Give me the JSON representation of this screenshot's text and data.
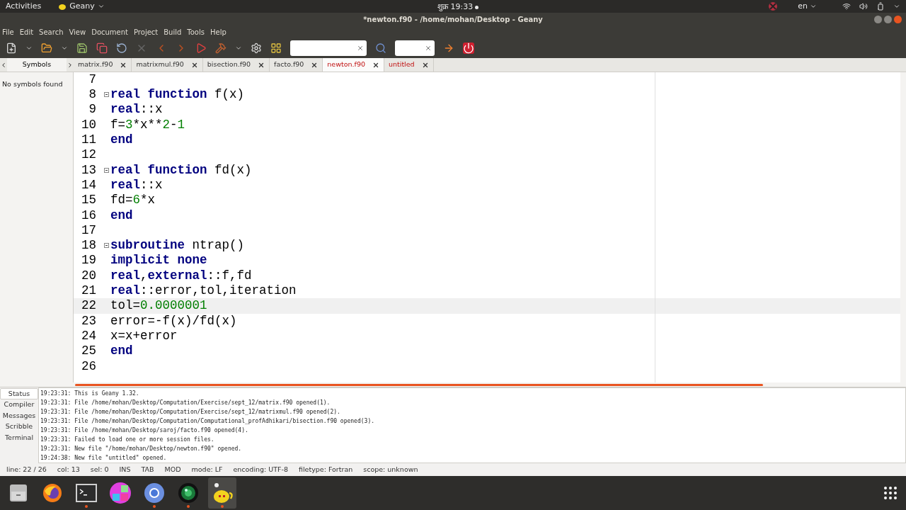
{
  "top_bar": {
    "activities": "Activities",
    "app_menu": "Geany",
    "clock": "शुक्र 19:33",
    "language": "en"
  },
  "window": {
    "title": "*newton.f90 - /home/mohan/Desktop - Geany"
  },
  "menu": [
    "File",
    "Edit",
    "Search",
    "View",
    "Document",
    "Project",
    "Build",
    "Tools",
    "Help"
  ],
  "sidebar": {
    "tab": "Symbols",
    "message": "No symbols found"
  },
  "tabs": [
    {
      "label": "matrix.f90",
      "selected": false,
      "modified": false
    },
    {
      "label": "matrixmul.f90",
      "selected": false,
      "modified": false
    },
    {
      "label": "bisection.f90",
      "selected": false,
      "modified": false
    },
    {
      "label": "facto.f90",
      "selected": false,
      "modified": false
    },
    {
      "label": "newton.f90",
      "selected": true,
      "modified": true
    },
    {
      "label": "untitled",
      "selected": false,
      "modified": true
    }
  ],
  "editor": {
    "lines": [
      {
        "number": "7",
        "fold": false,
        "current": false
      },
      {
        "number": "8",
        "fold": true,
        "current": false,
        "tokens": [
          {
            "t": "real function",
            "kind": "keyword"
          },
          {
            "t": " f(x)",
            "kind": "plain"
          }
        ]
      },
      {
        "number": "9",
        "fold": false,
        "current": false,
        "tokens": [
          {
            "t": "real",
            "kind": "keyword"
          },
          {
            "t": "::x",
            "kind": "plain"
          }
        ]
      },
      {
        "number": "10",
        "fold": false,
        "current": false,
        "tokens": [
          {
            "t": "f=",
            "kind": "plain"
          },
          {
            "t": "3",
            "kind": "number"
          },
          {
            "t": "*x**",
            "kind": "plain"
          },
          {
            "t": "2",
            "kind": "number"
          },
          {
            "t": "-",
            "kind": "plain"
          },
          {
            "t": "1",
            "kind": "number"
          }
        ]
      },
      {
        "number": "11",
        "fold": false,
        "current": false,
        "tokens": [
          {
            "t": "end",
            "kind": "keyword"
          }
        ]
      },
      {
        "number": "12",
        "fold": false,
        "current": false
      },
      {
        "number": "13",
        "fold": true,
        "current": false,
        "tokens": [
          {
            "t": "real function",
            "kind": "keyword"
          },
          {
            "t": " fd(x)",
            "kind": "plain"
          }
        ]
      },
      {
        "number": "14",
        "fold": false,
        "current": false,
        "tokens": [
          {
            "t": "real",
            "kind": "keyword"
          },
          {
            "t": "::x",
            "kind": "plain"
          }
        ]
      },
      {
        "number": "15",
        "fold": false,
        "current": false,
        "tokens": [
          {
            "t": "fd=",
            "kind": "plain"
          },
          {
            "t": "6",
            "kind": "number"
          },
          {
            "t": "*x",
            "kind": "plain"
          }
        ]
      },
      {
        "number": "16",
        "fold": false,
        "current": false,
        "tokens": [
          {
            "t": "end",
            "kind": "keyword"
          }
        ]
      },
      {
        "number": "17",
        "fold": false,
        "current": false
      },
      {
        "number": "18",
        "fold": true,
        "current": false,
        "tokens": [
          {
            "t": "subroutine",
            "kind": "keyword"
          },
          {
            "t": " ntrap()",
            "kind": "plain"
          }
        ]
      },
      {
        "number": "19",
        "fold": false,
        "current": false,
        "tokens": [
          {
            "t": "implicit none",
            "kind": "keyword"
          }
        ]
      },
      {
        "number": "20",
        "fold": false,
        "current": false,
        "tokens": [
          {
            "t": "real",
            "kind": "keyword"
          },
          {
            "t": ",",
            "kind": "plain"
          },
          {
            "t": "external",
            "kind": "keyword"
          },
          {
            "t": "::f,fd",
            "kind": "plain"
          }
        ]
      },
      {
        "number": "21",
        "fold": false,
        "current": false,
        "tokens": [
          {
            "t": "real",
            "kind": "keyword"
          },
          {
            "t": "::error,tol,iteration",
            "kind": "plain"
          }
        ]
      },
      {
        "number": "22",
        "fold": false,
        "current": true,
        "tokens": [
          {
            "t": "tol=",
            "kind": "plain"
          },
          {
            "t": "0.0000001",
            "kind": "number"
          }
        ]
      },
      {
        "number": "23",
        "fold": false,
        "current": false,
        "tokens": [
          {
            "t": "error=-f(x)/fd(x)",
            "kind": "plain"
          }
        ]
      },
      {
        "number": "24",
        "fold": false,
        "current": false,
        "tokens": [
          {
            "t": "x=x+error",
            "kind": "plain"
          }
        ]
      },
      {
        "number": "25",
        "fold": false,
        "current": false,
        "tokens": [
          {
            "t": "end",
            "kind": "keyword"
          }
        ]
      },
      {
        "number": "26",
        "fold": false,
        "current": false
      }
    ]
  },
  "message_tabs": [
    {
      "label": "Status",
      "selected": true
    },
    {
      "label": "Compiler",
      "selected": false
    },
    {
      "label": "Messages",
      "selected": false
    },
    {
      "label": "Scribble",
      "selected": false
    },
    {
      "label": "Terminal",
      "selected": false
    }
  ],
  "messages": [
    "19:23:31: This is Geany 1.32.",
    "19:23:31: File /home/mohan/Desktop/Computation/Exercise/sept_12/matrix.f90 opened(1).",
    "19:23:31: File /home/mohan/Desktop/Computation/Exercise/sept_12/matrixmul.f90 opened(2).",
    "19:23:31: File /home/mohan/Desktop/Computation/Computational_profAdhikari/bisection.f90 opened(3).",
    "19:23:31: File /home/mohan/Desktop/saroj/facto.f90 opened(4).",
    "19:23:31: Failed to load one or more session files.",
    "19:23:31: New file \"/home/mohan/Desktop/newton.f90\" opened.",
    "19:24:38: New file \"untitled\" opened."
  ],
  "status_bar": [
    "line: 22 / 26",
    "col: 13",
    "sel: 0",
    "INS",
    "TAB",
    "MOD",
    "mode: LF",
    "encoding: UTF-8",
    "filetype: Fortran",
    "scope: unknown"
  ],
  "dock": [
    {
      "kind": "files",
      "running": false
    },
    {
      "kind": "browser",
      "running": false
    },
    {
      "kind": "terminal",
      "running": true
    },
    {
      "kind": "grid",
      "running": false
    },
    {
      "kind": "chrome",
      "running": true
    },
    {
      "kind": "camera",
      "running": true
    },
    {
      "kind": "geany",
      "running": true
    }
  ]
}
